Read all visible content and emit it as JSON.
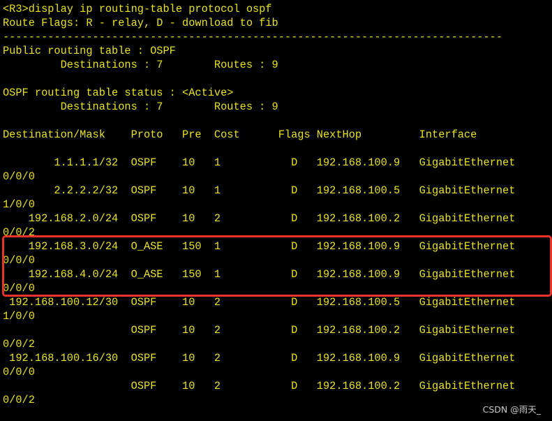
{
  "terminal": {
    "text_color": "#e8e31c",
    "background": "#000000",
    "highlight_color": "#e8332a",
    "lines": [
      "<R3>display ip routing-table protocol ospf",
      "Route Flags: R - relay, D - download to fib",
      "------------------------------------------------------------------------------",
      "Public routing table : OSPF",
      "         Destinations : 7        Routes : 9",
      "",
      "OSPF routing table status : <Active>",
      "         Destinations : 7        Routes : 9",
      "",
      "Destination/Mask    Proto   Pre  Cost      Flags NextHop         Interface",
      "",
      "        1.1.1.1/32  OSPF    10   1           D   192.168.100.9   GigabitEthernet",
      "0/0/0",
      "        2.2.2.2/32  OSPF    10   1           D   192.168.100.5   GigabitEthernet",
      "1/0/0",
      "    192.168.2.0/24  OSPF    10   2           D   192.168.100.2   GigabitEthernet",
      "0/0/2",
      "    192.168.3.0/24  O_ASE   150  1           D   192.168.100.9   GigabitEthernet",
      "0/0/0",
      "    192.168.4.0/24  O_ASE   150  1           D   192.168.100.9   GigabitEthernet",
      "0/0/0",
      " 192.168.100.12/30  OSPF    10   2           D   192.168.100.5   GigabitEthernet",
      "1/0/0",
      "                    OSPF    10   2           D   192.168.100.2   GigabitEthernet",
      "0/0/2",
      " 192.168.100.16/30  OSPF    10   2           D   192.168.100.9   GigabitEthernet",
      "0/0/0",
      "                    OSPF    10   2           D   192.168.100.2   GigabitEthernet",
      "0/0/2"
    ]
  },
  "watermark": "CSDN @雨天_"
}
